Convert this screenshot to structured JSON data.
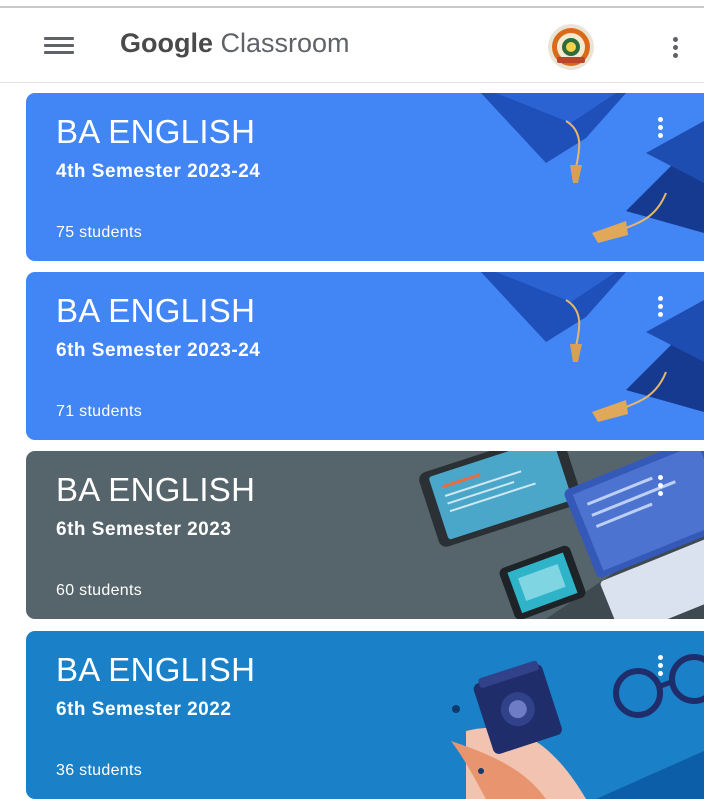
{
  "app": {
    "brand_bold": "Google",
    "brand_rest": "Classroom"
  },
  "icons": {
    "menu": "hamburger-menu-icon",
    "account": "institution-seal-avatar",
    "more": "more-vert-icon"
  },
  "classes": [
    {
      "title": "BA ENGLISH",
      "section": "4th Semester 2023-24",
      "count": "75 students",
      "theme": "blue",
      "illustration": "graduation-caps",
      "color": "#4285f4"
    },
    {
      "title": "BA ENGLISH",
      "section": "6th Semester 2023-24",
      "count": "71 students",
      "theme": "blue",
      "illustration": "graduation-caps",
      "color": "#4285f4"
    },
    {
      "title": "BA ENGLISH",
      "section": "6th Semester 2023",
      "count": "60 students",
      "theme": "slate",
      "illustration": "devices",
      "color": "#56656b"
    },
    {
      "title": "BA ENGLISH",
      "section": "6th Semester 2022",
      "count": "36 students",
      "theme": "teal",
      "illustration": "desk-objects",
      "color": "#1a80c7"
    }
  ]
}
